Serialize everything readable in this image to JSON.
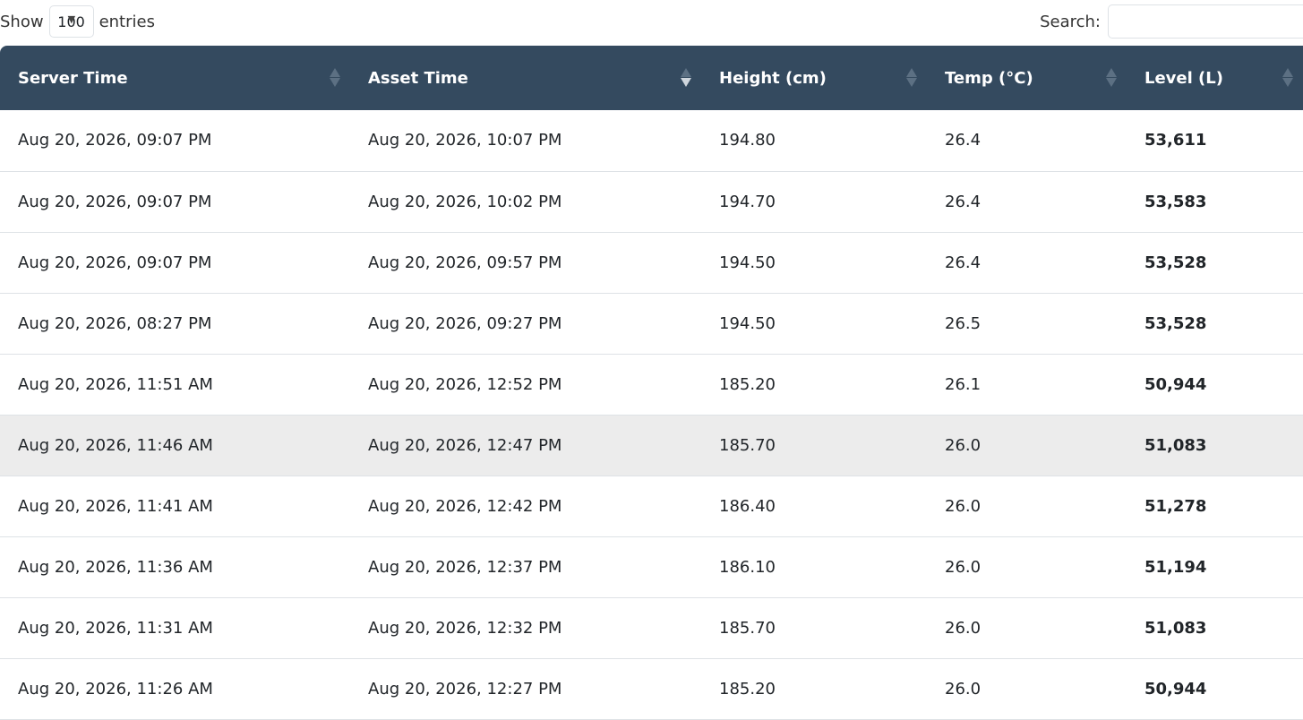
{
  "controls": {
    "show_label": "Show",
    "page_length": "100",
    "entries_label": "entries",
    "search_label": "Search:",
    "search_value": ""
  },
  "table": {
    "columns": [
      {
        "label": "Server Time",
        "sort": "none"
      },
      {
        "label": "Asset Time",
        "sort": "desc"
      },
      {
        "label": "Height (cm)",
        "sort": "none"
      },
      {
        "label": "Temp (°C)",
        "sort": "none"
      },
      {
        "label": "Level (L)",
        "sort": "none"
      }
    ],
    "rows": [
      {
        "server_time": "Aug 20, 2026, 09:07 PM",
        "asset_time": "Aug 20, 2026, 10:07 PM",
        "height": "194.80",
        "temp": "26.4",
        "level": "53,611"
      },
      {
        "server_time": "Aug 20, 2026, 09:07 PM",
        "asset_time": "Aug 20, 2026, 10:02 PM",
        "height": "194.70",
        "temp": "26.4",
        "level": "53,583"
      },
      {
        "server_time": "Aug 20, 2026, 09:07 PM",
        "asset_time": "Aug 20, 2026, 09:57 PM",
        "height": "194.50",
        "temp": "26.4",
        "level": "53,528"
      },
      {
        "server_time": "Aug 20, 2026, 08:27 PM",
        "asset_time": "Aug 20, 2026, 09:27 PM",
        "height": "194.50",
        "temp": "26.5",
        "level": "53,528"
      },
      {
        "server_time": "Aug 20, 2026, 11:51 AM",
        "asset_time": "Aug 20, 2026, 12:52 PM",
        "height": "185.20",
        "temp": "26.1",
        "level": "50,944"
      },
      {
        "server_time": "Aug 20, 2026, 11:46 AM",
        "asset_time": "Aug 20, 2026, 12:47 PM",
        "height": "185.70",
        "temp": "26.0",
        "level": "51,083"
      },
      {
        "server_time": "Aug 20, 2026, 11:41 AM",
        "asset_time": "Aug 20, 2026, 12:42 PM",
        "height": "186.40",
        "temp": "26.0",
        "level": "51,278"
      },
      {
        "server_time": "Aug 20, 2026, 11:36 AM",
        "asset_time": "Aug 20, 2026, 12:37 PM",
        "height": "186.10",
        "temp": "26.0",
        "level": "51,194"
      },
      {
        "server_time": "Aug 20, 2026, 11:31 AM",
        "asset_time": "Aug 20, 2026, 12:32 PM",
        "height": "185.70",
        "temp": "26.0",
        "level": "51,083"
      },
      {
        "server_time": "Aug 20, 2026, 11:26 AM",
        "asset_time": "Aug 20, 2026, 12:27 PM",
        "height": "185.20",
        "temp": "26.0",
        "level": "50,944"
      }
    ],
    "hovered_row_index": 5
  },
  "colors": {
    "header_bg": "#344a5f",
    "header_text": "#ffffff",
    "hover_row_bg": "#ececec",
    "row_border": "#dee2e6"
  }
}
